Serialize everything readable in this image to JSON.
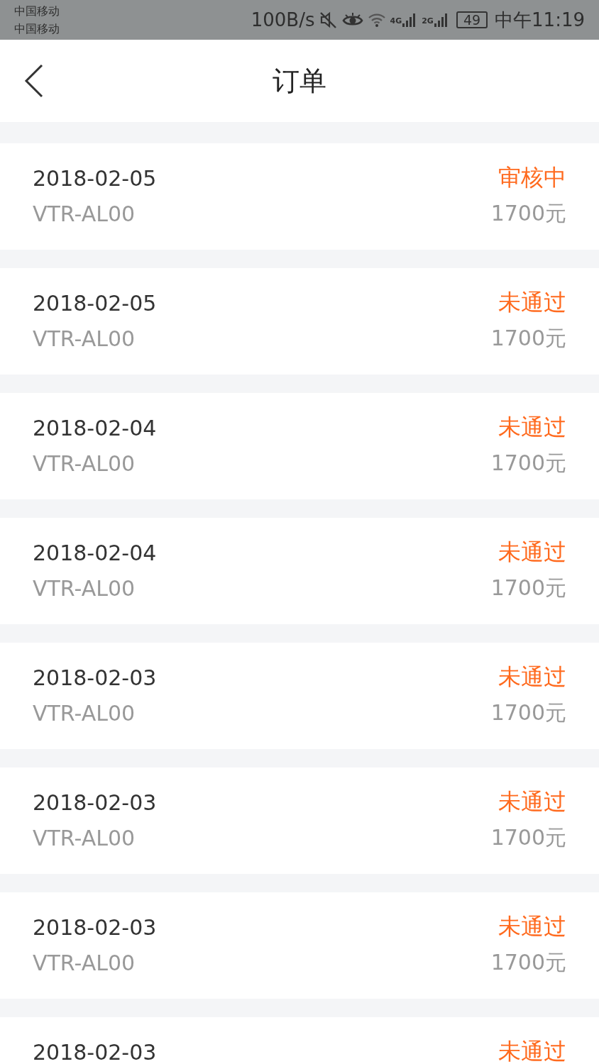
{
  "status_bar": {
    "carriers": [
      "中国移动",
      "中国移动"
    ],
    "speed": "100B/s",
    "network_1": "4G",
    "network_2": "2G",
    "battery": "49",
    "time": "中午11:19"
  },
  "header": {
    "title": "订单"
  },
  "orders": [
    {
      "date": "2018-02-05",
      "model": "VTR-AL00",
      "status": "审核中",
      "amount": "1700元"
    },
    {
      "date": "2018-02-05",
      "model": "VTR-AL00",
      "status": "未通过",
      "amount": "1700元"
    },
    {
      "date": "2018-02-04",
      "model": "VTR-AL00",
      "status": "未通过",
      "amount": "1700元"
    },
    {
      "date": "2018-02-04",
      "model": "VTR-AL00",
      "status": "未通过",
      "amount": "1700元"
    },
    {
      "date": "2018-02-03",
      "model": "VTR-AL00",
      "status": "未通过",
      "amount": "1700元"
    },
    {
      "date": "2018-02-03",
      "model": "VTR-AL00",
      "status": "未通过",
      "amount": "1700元"
    },
    {
      "date": "2018-02-03",
      "model": "VTR-AL00",
      "status": "未通过",
      "amount": "1700元"
    },
    {
      "date": "2018-02-03",
      "status": "未通过"
    }
  ]
}
